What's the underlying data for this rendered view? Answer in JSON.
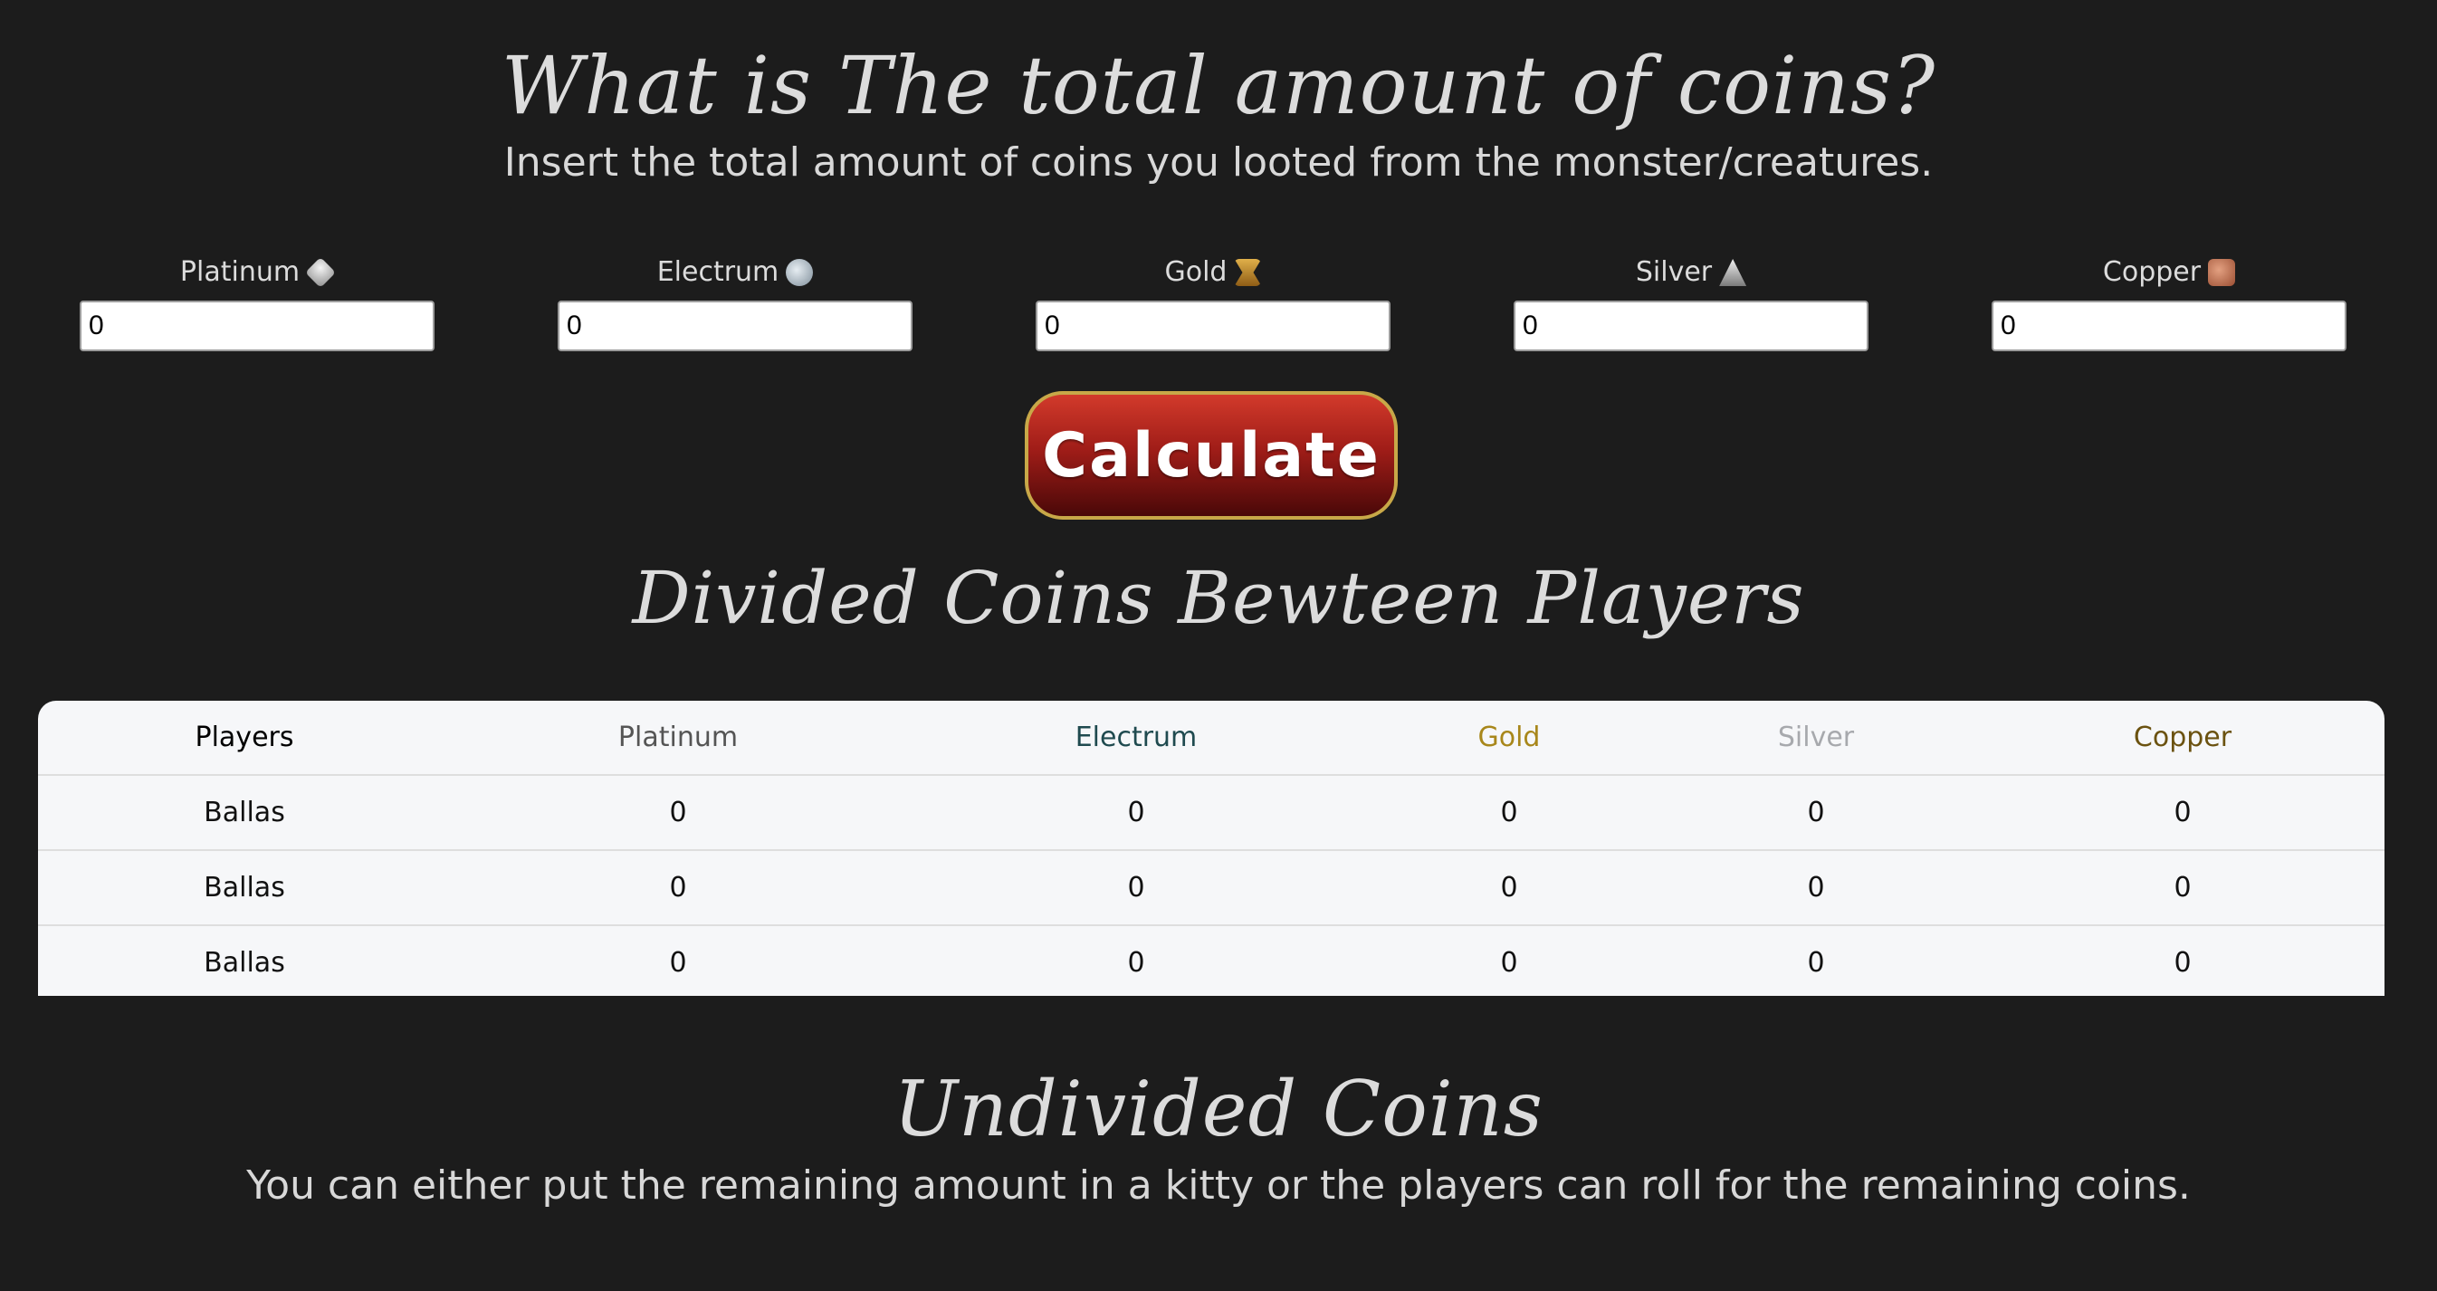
{
  "header": {
    "title": "What is The total amount of coins?",
    "subtitle": "Insert the total amount of coins you looted from the monster/creatures."
  },
  "coins": [
    {
      "label": "Platinum",
      "icon": "platinum-coin-icon",
      "value": "0",
      "color": "#cfcfcf"
    },
    {
      "label": "Electrum",
      "icon": "electrum-coin-icon",
      "value": "0",
      "color": "#9fb0bd"
    },
    {
      "label": "Gold",
      "icon": "gold-coin-icon",
      "value": "0",
      "color": "#c89a3a"
    },
    {
      "label": "Silver",
      "icon": "silver-coin-icon",
      "value": "0",
      "color": "#bdbdbd"
    },
    {
      "label": "Copper",
      "icon": "copper-coin-icon",
      "value": "0",
      "color": "#c27a5a"
    }
  ],
  "calculate_label": "Calculate",
  "divided": {
    "title": "Divided Coins Bewteen Players",
    "columns": [
      {
        "label": "Players",
        "color": "#000000"
      },
      {
        "label": "Platinum",
        "color": "#555555"
      },
      {
        "label": "Electrum",
        "color": "#1f4a4f"
      },
      {
        "label": "Gold",
        "color": "#a8871b"
      },
      {
        "label": "Silver",
        "color": "#a7a9ad"
      },
      {
        "label": "Copper",
        "color": "#6b5210"
      }
    ],
    "rows": [
      [
        "Ballas",
        "0",
        "0",
        "0",
        "0",
        "0"
      ],
      [
        "Ballas",
        "0",
        "0",
        "0",
        "0",
        "0"
      ],
      [
        "Ballas",
        "0",
        "0",
        "0",
        "0",
        "0"
      ]
    ]
  },
  "undivided": {
    "title": "Undivided Coins",
    "subtitle": "You can either put the remaining amount in a kitty or the players can roll for the remaining coins."
  }
}
